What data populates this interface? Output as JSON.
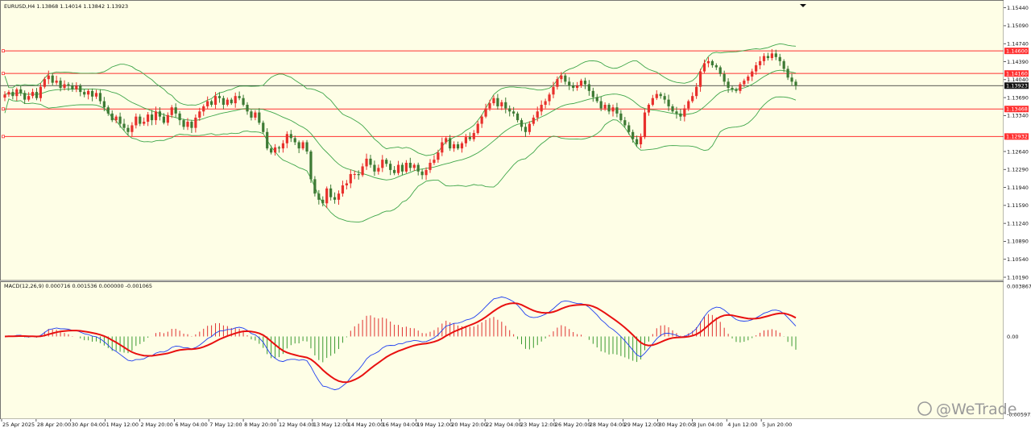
{
  "window": {
    "symbol_info": "EURUSD,H4  1.13868 1.14014 1.13842 1.13923",
    "macd_info": "MACD(12,26,9) 0.000716 0.001536 0.000000 -0.001065",
    "watermark": "@WeTrade"
  },
  "colors": {
    "background": "#fefee6",
    "bull": "#e8302c",
    "bear": "#3d7a34",
    "bands": "#3fa64a",
    "level_line": "#ff3030",
    "macd_main": "#1f3ff0",
    "macd_signal": "#e81010",
    "hist_up": "#e03030",
    "hist_down": "#3a9a30"
  },
  "price_axis": {
    "labels": [
      "1.15440",
      "1.15090",
      "1.14740",
      "1.14390",
      "1.14040",
      "1.13690",
      "1.13340",
      "1.12640",
      "1.12290",
      "1.11940",
      "1.11590",
      "1.11240",
      "1.10890",
      "1.10540",
      "1.10190"
    ],
    "min": 1.1019,
    "max": 1.1556
  },
  "price_tags": [
    {
      "text": "1.14600",
      "price": 1.146,
      "kind": "level"
    },
    {
      "text": "1.14160",
      "price": 1.1416,
      "kind": "level"
    },
    {
      "text": "1.13923",
      "price": 1.13923,
      "kind": "current"
    },
    {
      "text": "1.13468",
      "price": 1.13468,
      "kind": "level"
    },
    {
      "text": "1.12932",
      "price": 1.12932,
      "kind": "level"
    }
  ],
  "macd_axis": {
    "labels": [
      "0.003867",
      "0.00",
      "-0.005975"
    ],
    "values": [
      0.003867,
      0.0,
      -0.005975
    ]
  },
  "time_axis": {
    "labels": [
      "25 Apr 2025",
      "28 Apr 20:00",
      "30 Apr 04:00",
      "1 May 12:00",
      "2 May 20:00",
      "6 May 04:00",
      "7 May 12:00",
      "8 May 20:00",
      "12 May 04:00",
      "13 May 12:00",
      "14 May 20:00",
      "16 May 04:00",
      "19 May 12:00",
      "20 May 20:00",
      "22 May 04:00",
      "23 May 12:00",
      "26 May 20:00",
      "28 May 04:00",
      "29 May 12:00",
      "30 May 20:00",
      "3 Jun 04:00",
      "4 Jun 12:00",
      "5 Jun 20:00"
    ]
  },
  "chart_data": {
    "type": "candlestick",
    "symbol": "EURUSD",
    "timeframe": "H4",
    "closes": [
      1.1375,
      1.138,
      1.1372,
      1.1385,
      1.1378,
      1.1365,
      1.1372,
      1.138,
      1.1368,
      1.139,
      1.1405,
      1.1412,
      1.1398,
      1.1402,
      1.1388,
      1.1395,
      1.1392,
      1.1385,
      1.1392,
      1.138,
      1.1375,
      1.1382,
      1.1371,
      1.1378,
      1.1362,
      1.135,
      1.1338,
      1.1325,
      1.1332,
      1.1318,
      1.131,
      1.1302,
      1.1315,
      1.1332,
      1.1318,
      1.1322,
      1.1336,
      1.1325,
      1.1342,
      1.1332,
      1.132,
      1.1335,
      1.135,
      1.1338,
      1.1325,
      1.1312,
      1.1322,
      1.131,
      1.133,
      1.1342,
      1.1352,
      1.1362,
      1.1355,
      1.1372,
      1.1368,
      1.1355,
      1.1365,
      1.1358,
      1.1372,
      1.1368,
      1.1355,
      1.1342,
      1.133,
      1.134,
      1.132,
      1.1302,
      1.127,
      1.1262,
      1.1272,
      1.127,
      1.128,
      1.1298,
      1.129,
      1.1282,
      1.127,
      1.1282,
      1.1264,
      1.121,
      1.1182,
      1.117,
      1.1163,
      1.1192,
      1.1175,
      1.117,
      1.1182,
      1.1198,
      1.1202,
      1.122,
      1.122,
      1.1218,
      1.1235,
      1.125,
      1.1238,
      1.1225,
      1.1232,
      1.1248,
      1.124,
      1.1228,
      1.1222,
      1.1238,
      1.1225,
      1.1242,
      1.1232,
      1.1238,
      1.1225,
      1.1218,
      1.1228,
      1.1242,
      1.1248,
      1.1262,
      1.1282,
      1.129,
      1.127,
      1.1278,
      1.127,
      1.128,
      1.1292,
      1.1288,
      1.13,
      1.1318,
      1.1332,
      1.1348,
      1.1358,
      1.1368,
      1.1352,
      1.136,
      1.1348,
      1.1342,
      1.1338,
      1.1325,
      1.1312,
      1.1302,
      1.1318,
      1.133,
      1.1342,
      1.1355,
      1.1362,
      1.1375,
      1.139,
      1.1405,
      1.1412,
      1.14,
      1.1392,
      1.1388,
      1.1392,
      1.1402,
      1.1395,
      1.1382,
      1.137,
      1.1362,
      1.1348,
      1.1355,
      1.1342,
      1.135,
      1.1338,
      1.1325,
      1.1315,
      1.1302,
      1.1288,
      1.1278,
      1.1292,
      1.134,
      1.1355,
      1.1368,
      1.1376,
      1.1372,
      1.1365,
      1.1352,
      1.1342,
      1.1338,
      1.1332,
      1.1348,
      1.1362,
      1.1372,
      1.139,
      1.142,
      1.1436,
      1.144,
      1.1432,
      1.1428,
      1.1415,
      1.14,
      1.1388,
      1.1385,
      1.1382,
      1.1395,
      1.1402,
      1.141,
      1.142,
      1.1432,
      1.144,
      1.145,
      1.1446,
      1.1455,
      1.1448,
      1.144,
      1.1425,
      1.1408,
      1.14,
      1.13923
    ]
  }
}
